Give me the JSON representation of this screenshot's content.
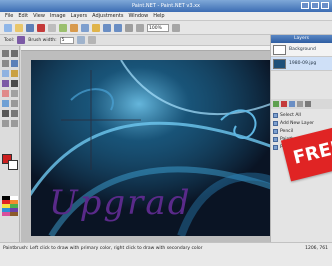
{
  "window": {
    "title": "Paint.NET - Paint.NET v3.xx"
  },
  "menu": [
    "File",
    "Edit",
    "View",
    "Image",
    "Layers",
    "Adjustments",
    "Window",
    "Help"
  ],
  "toolbar": {
    "zoom_value": "100%"
  },
  "options": {
    "tool_label": "Tool:",
    "brush_width_label": "Brush width:",
    "brush_width_value": "5"
  },
  "layers_panel": {
    "title": "Layers",
    "layers": [
      {
        "name": "Background"
      },
      {
        "name": "1980-09.jpg"
      }
    ]
  },
  "history_panel": {
    "items": [
      "Select All",
      "Add New Layer",
      "Pencil",
      "Paintbrush",
      "Paintbrush"
    ]
  },
  "canvas": {
    "handwriting": "Upgrad"
  },
  "promo": {
    "banner_text": "FREE"
  },
  "status": {
    "message": "Paintbrush: Left click to draw with primary color, right click to draw with secondary color",
    "coords": "1206, 761"
  },
  "colors": {
    "title_bar": "#3c6db3",
    "banner": "#e02424",
    "canvas_bg": "#0a1424",
    "glow": "#6fc8f0",
    "ink": "#5a2a8a"
  }
}
